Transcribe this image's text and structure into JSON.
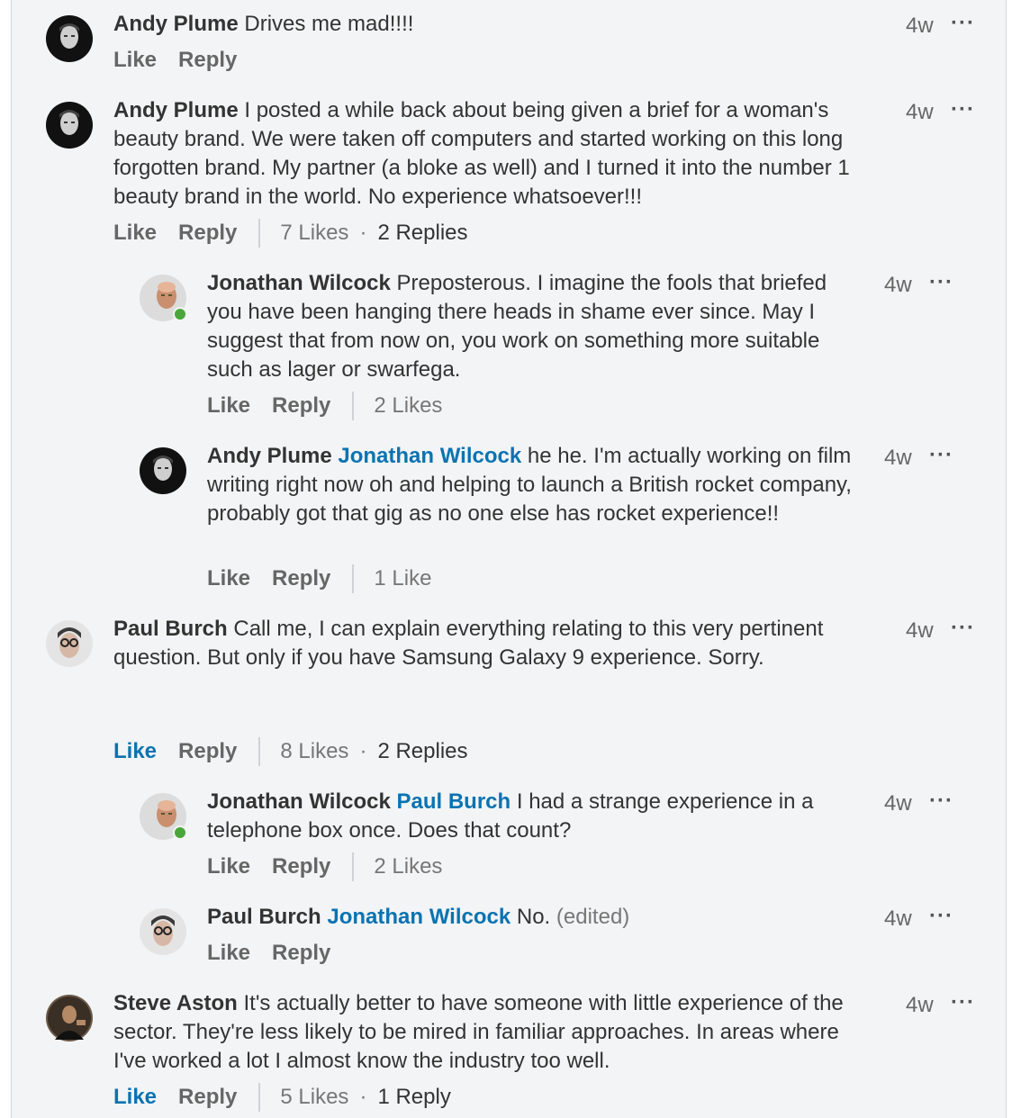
{
  "comments": [
    {
      "author": "Andy Plume",
      "text": "Drives me mad!!!!",
      "time": "4w",
      "like": "Like",
      "reply": "Reply",
      "more": "···"
    },
    {
      "author": "Andy Plume",
      "text": "I posted a while back about being given a brief for a woman's beauty brand. We were taken off computers and started working on this long forgotten brand. My partner (a bloke as well) and I turned it into the number 1 beauty brand in the world. No experience whatsoever!!!",
      "time": "4w",
      "like": "Like",
      "reply": "Reply",
      "likes_count": "7 Likes",
      "replies_count": "2 Replies",
      "more": "···"
    },
    {
      "author": "Jonathan Wilcock",
      "text": "Preposterous. I imagine the fools that briefed you have been hanging there heads in shame ever since. May I suggest that from now on, you work on something more suitable such as lager or swarfega.",
      "time": "4w",
      "like": "Like",
      "reply": "Reply",
      "likes_count": "2 Likes",
      "more": "···"
    },
    {
      "author": "Andy Plume",
      "mention": "Jonathan Wilcock",
      "text": "he he. I'm actually working on film writing right now oh and helping to launch a British rocket company, probably got that gig as no one else has rocket experience!!",
      "time": "4w",
      "like": "Like",
      "reply": "Reply",
      "likes_count": "1 Like",
      "more": "···"
    },
    {
      "author": "Paul Burch",
      "text": "Call me,  I can explain everything relating to this very pertinent question.  But only if you have Samsung Galaxy 9 experience. Sorry.",
      "time": "4w",
      "like": "Like",
      "reply": "Reply",
      "likes_count": "8 Likes",
      "replies_count": "2 Replies",
      "more": "···"
    },
    {
      "author": "Jonathan Wilcock",
      "mention": "Paul Burch",
      "text": "I had a strange experience in a telephone box once. Does that count?",
      "time": "4w",
      "like": "Like",
      "reply": "Reply",
      "likes_count": "2 Likes",
      "more": "···"
    },
    {
      "author": "Paul Burch",
      "mention": "Jonathan Wilcock",
      "text": "No.",
      "edited": "(edited)",
      "time": "4w",
      "like": "Like",
      "reply": "Reply",
      "more": "···"
    },
    {
      "author": "Steve Aston",
      "text": "It's actually better to have someone with little experience of the sector. They're less likely to be mired in familiar approaches. In areas where I've worked a lot I almost know the industry too well.",
      "time": "4w",
      "like": "Like",
      "reply": "Reply",
      "likes_count": "5 Likes",
      "replies_count": "1 Reply",
      "more": "···"
    }
  ],
  "bullet": "·",
  "colors": {
    "link": "#0a73b1",
    "online": "#4aa63a",
    "panel_bg": "#f3f4f5"
  }
}
